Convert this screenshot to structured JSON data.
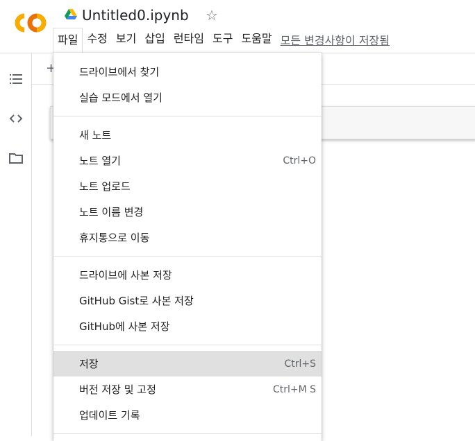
{
  "header": {
    "title": "Untitled0.ipynb",
    "star": "☆",
    "save_status": "모든 변경사항이 저장됨"
  },
  "menubar": {
    "items": [
      {
        "label": "파일"
      },
      {
        "label": "수정"
      },
      {
        "label": "보기"
      },
      {
        "label": "삽입"
      },
      {
        "label": "런타임"
      },
      {
        "label": "도구"
      },
      {
        "label": "도움말"
      }
    ]
  },
  "toolbar": {
    "add_label": "+"
  },
  "file_menu": {
    "group1": [
      {
        "label": "드라이브에서 찾기",
        "shortcut": ""
      },
      {
        "label": "실습 모드에서 열기",
        "shortcut": ""
      }
    ],
    "group2": [
      {
        "label": "새 노트",
        "shortcut": ""
      },
      {
        "label": "노트 열기",
        "shortcut": "Ctrl+O"
      },
      {
        "label": "노트 업로드",
        "shortcut": ""
      },
      {
        "label": "노트 이름 변경",
        "shortcut": ""
      },
      {
        "label": "휴지통으로 이동",
        "shortcut": ""
      }
    ],
    "group3": [
      {
        "label": "드라이브에 사본 저장",
        "shortcut": ""
      },
      {
        "label": "GitHub Gist로 사본 저장",
        "shortcut": ""
      },
      {
        "label": "GitHub에 사본 저장",
        "shortcut": ""
      }
    ],
    "group4": [
      {
        "label": "저장",
        "shortcut": "Ctrl+S"
      },
      {
        "label": "버전 저장 및 고정",
        "shortcut": "Ctrl+M S"
      },
      {
        "label": "업데이트 기록",
        "shortcut": ""
      }
    ]
  },
  "colors": {
    "logo_orange": "#f9ab00",
    "logo_dark_orange": "#e8710a",
    "highlight": "#e0e0e0"
  }
}
